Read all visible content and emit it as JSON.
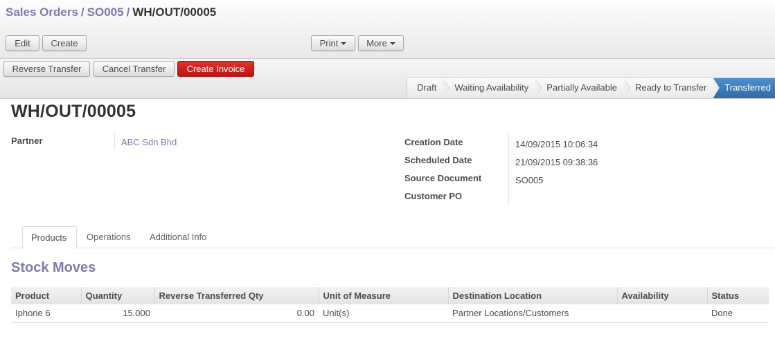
{
  "breadcrumb": {
    "root": "Sales Orders",
    "parent": "SO005",
    "current": "WH/OUT/00005",
    "separator": "/"
  },
  "toolbar": {
    "edit_label": "Edit",
    "create_label": "Create",
    "print_label": "Print",
    "more_label": "More"
  },
  "actions": {
    "reverse_transfer_label": "Reverse Transfer",
    "cancel_transfer_label": "Cancel Transfer",
    "create_invoice_label": "Create Invoice"
  },
  "statusbar": {
    "stages": [
      "Draft",
      "Waiting Availability",
      "Partially Available",
      "Ready to Transfer",
      "Transferred"
    ],
    "active": "Transferred"
  },
  "form": {
    "title": "WH/OUT/00005",
    "partner_label": "Partner",
    "partner_value": "ABC Sdn Bhd",
    "creation_date_label": "Creation Date",
    "creation_date_value": "14/09/2015 10:06:34",
    "scheduled_date_label": "Scheduled Date",
    "scheduled_date_value": "21/09/2015 09:38:36",
    "source_document_label": "Source Document",
    "source_document_value": "SO005",
    "customer_po_label": "Customer PO",
    "customer_po_value": ""
  },
  "tabs": {
    "products": "Products",
    "operations": "Operations",
    "additional_info": "Additional Info"
  },
  "stock_moves": {
    "title": "Stock Moves",
    "columns": [
      "Product",
      "Quantity",
      "Reverse Transferred Qty",
      "Unit of Measure",
      "Destination Location",
      "Availability",
      "Status"
    ],
    "rows": [
      [
        "Iphone 6",
        "15.000",
        "0.00",
        "Unit(s)",
        "Partner Locations/Customers",
        "",
        "Done"
      ]
    ]
  },
  "colors": {
    "brand_link": "#7c7bad",
    "danger_button": "#c9201d",
    "active_stage": "#3f7dbd"
  }
}
